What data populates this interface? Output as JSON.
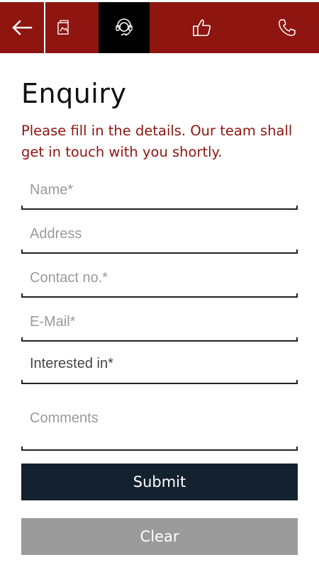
{
  "nav": {
    "back_icon": "arrow-left-icon",
    "tabs": [
      {
        "icon": "gallery-icon"
      },
      {
        "icon": "support-headset-icon",
        "active": true
      },
      {
        "icon": "thumbs-up-icon"
      },
      {
        "icon": "phone-icon"
      }
    ],
    "bar_color": "#8e1510",
    "active_color": "#000000"
  },
  "page": {
    "title": "Enquiry",
    "subtitle": "Please fill in the details. Our team shall get in touch with you shortly."
  },
  "form": {
    "name_placeholder": "Name*",
    "address_placeholder": "Address",
    "contact_placeholder": "Contact no.*",
    "email_placeholder": "E-Mail*",
    "interested_label": "Interested in*",
    "comments_placeholder": "Comments"
  },
  "buttons": {
    "submit": "Submit",
    "clear": "Clear",
    "submit_color": "#14222f",
    "clear_color": "#9b9b9b"
  }
}
